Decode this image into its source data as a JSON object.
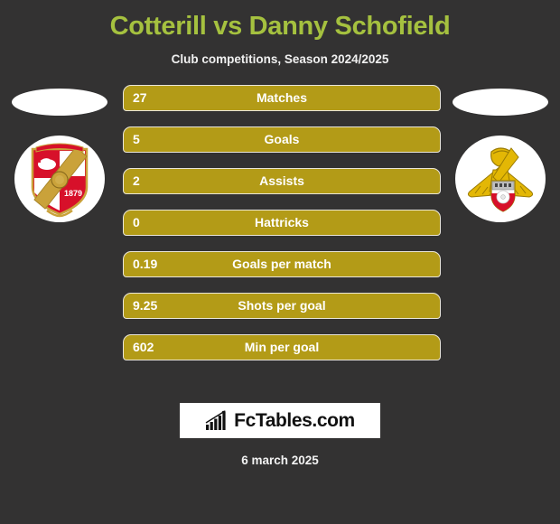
{
  "header": {
    "title": "Cotterill vs Danny Schofield",
    "subtitle": "Club competitions, Season 2024/2025",
    "title_color": "#a5c13f"
  },
  "theme": {
    "background": "#333232",
    "bar_color": "#b39b17",
    "bar_border": "#eae6d8",
    "text_color": "#ffffff"
  },
  "left_side": {
    "photo": "player-photo-placeholder",
    "crest": "swindon-town-crest",
    "crest_year": "1879"
  },
  "right_side": {
    "photo": "player-photo-placeholder",
    "crest": "doncaster-rovers-crest"
  },
  "stats": [
    {
      "value": "27",
      "label": "Matches"
    },
    {
      "value": "5",
      "label": "Goals"
    },
    {
      "value": "2",
      "label": "Assists"
    },
    {
      "value": "0",
      "label": "Hattricks"
    },
    {
      "value": "0.19",
      "label": "Goals per match"
    },
    {
      "value": "9.25",
      "label": "Shots per goal"
    },
    {
      "value": "602",
      "label": "Min per goal"
    }
  ],
  "footer": {
    "logo_text": "FcTables.com",
    "logo_icon": "bar-chart-growth-icon",
    "date": "6 march 2025"
  }
}
